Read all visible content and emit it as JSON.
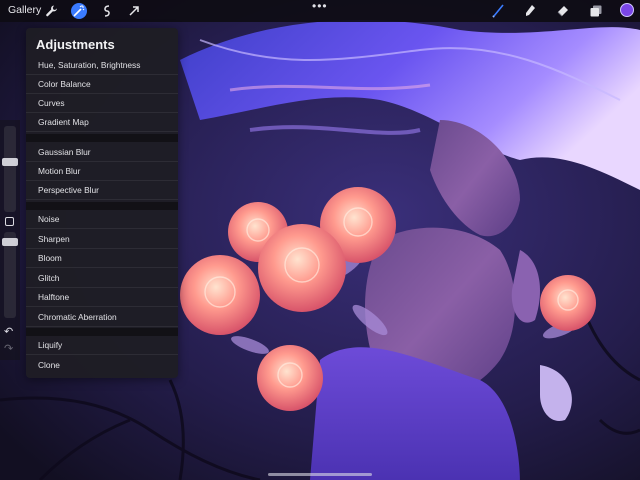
{
  "toolbar": {
    "gallery_label": "Gallery",
    "more_label": "•••",
    "color_swatch": "#7a46e8",
    "accent": "#3a7bff"
  },
  "adjustments": {
    "title": "Adjustments",
    "groups": [
      [
        "Hue, Saturation, Brightness",
        "Color Balance",
        "Curves",
        "Gradient Map"
      ],
      [
        "Gaussian Blur",
        "Motion Blur",
        "Perspective Blur"
      ],
      [
        "Noise",
        "Sharpen",
        "Bloom",
        "Glitch",
        "Halftone",
        "Chromatic Aberration"
      ],
      [
        "Liquify",
        "Clone"
      ]
    ]
  },
  "icons": [
    "wrench-icon",
    "magic-wand-icon",
    "selection-icon",
    "transform-arrow-icon",
    "brush-icon",
    "smudge-icon",
    "eraser-icon",
    "layers-icon",
    "undo-icon",
    "redo-icon"
  ]
}
